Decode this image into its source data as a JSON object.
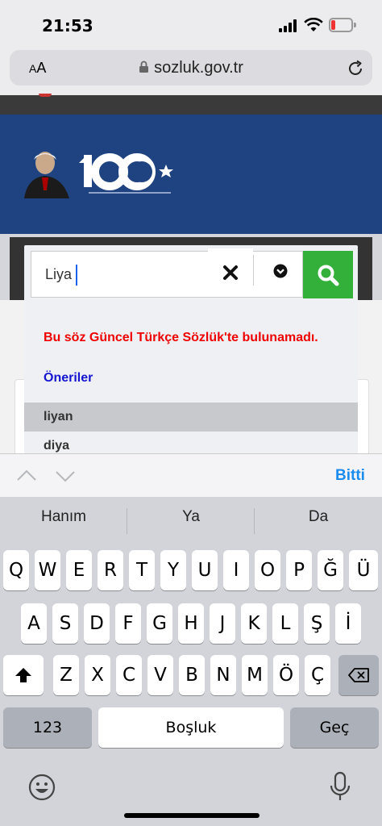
{
  "status_bar": {
    "time": "21:53"
  },
  "browser": {
    "text_size_label": "AA",
    "url": "sozluk.gov.tr"
  },
  "search": {
    "query": "Liya",
    "error_message": "Bu söz Güncel Türkçe Sözlük'te bulunamadı.",
    "suggestions_title": "Öneriler",
    "suggestions": [
      "liyan",
      "diya"
    ]
  },
  "accessory_bar": {
    "done_label": "Bitti"
  },
  "keyboard": {
    "predictions": [
      "Hanım",
      "Ya",
      "Da"
    ],
    "row1": [
      "Q",
      "W",
      "E",
      "R",
      "T",
      "Y",
      "U",
      "I",
      "O",
      "P",
      "Ğ",
      "Ü"
    ],
    "row2": [
      "A",
      "S",
      "D",
      "F",
      "G",
      "H",
      "J",
      "K",
      "L",
      "Ş",
      "İ"
    ],
    "row3": [
      "Z",
      "X",
      "C",
      "V",
      "B",
      "N",
      "M",
      "Ö",
      "Ç"
    ],
    "numbers_label": "123",
    "space_label": "Boşluk",
    "return_label": "Geç"
  },
  "colors": {
    "banner": "#1f4381",
    "search_button": "#33b03a",
    "error": "#e00000",
    "accent": "#1a8cf0"
  }
}
